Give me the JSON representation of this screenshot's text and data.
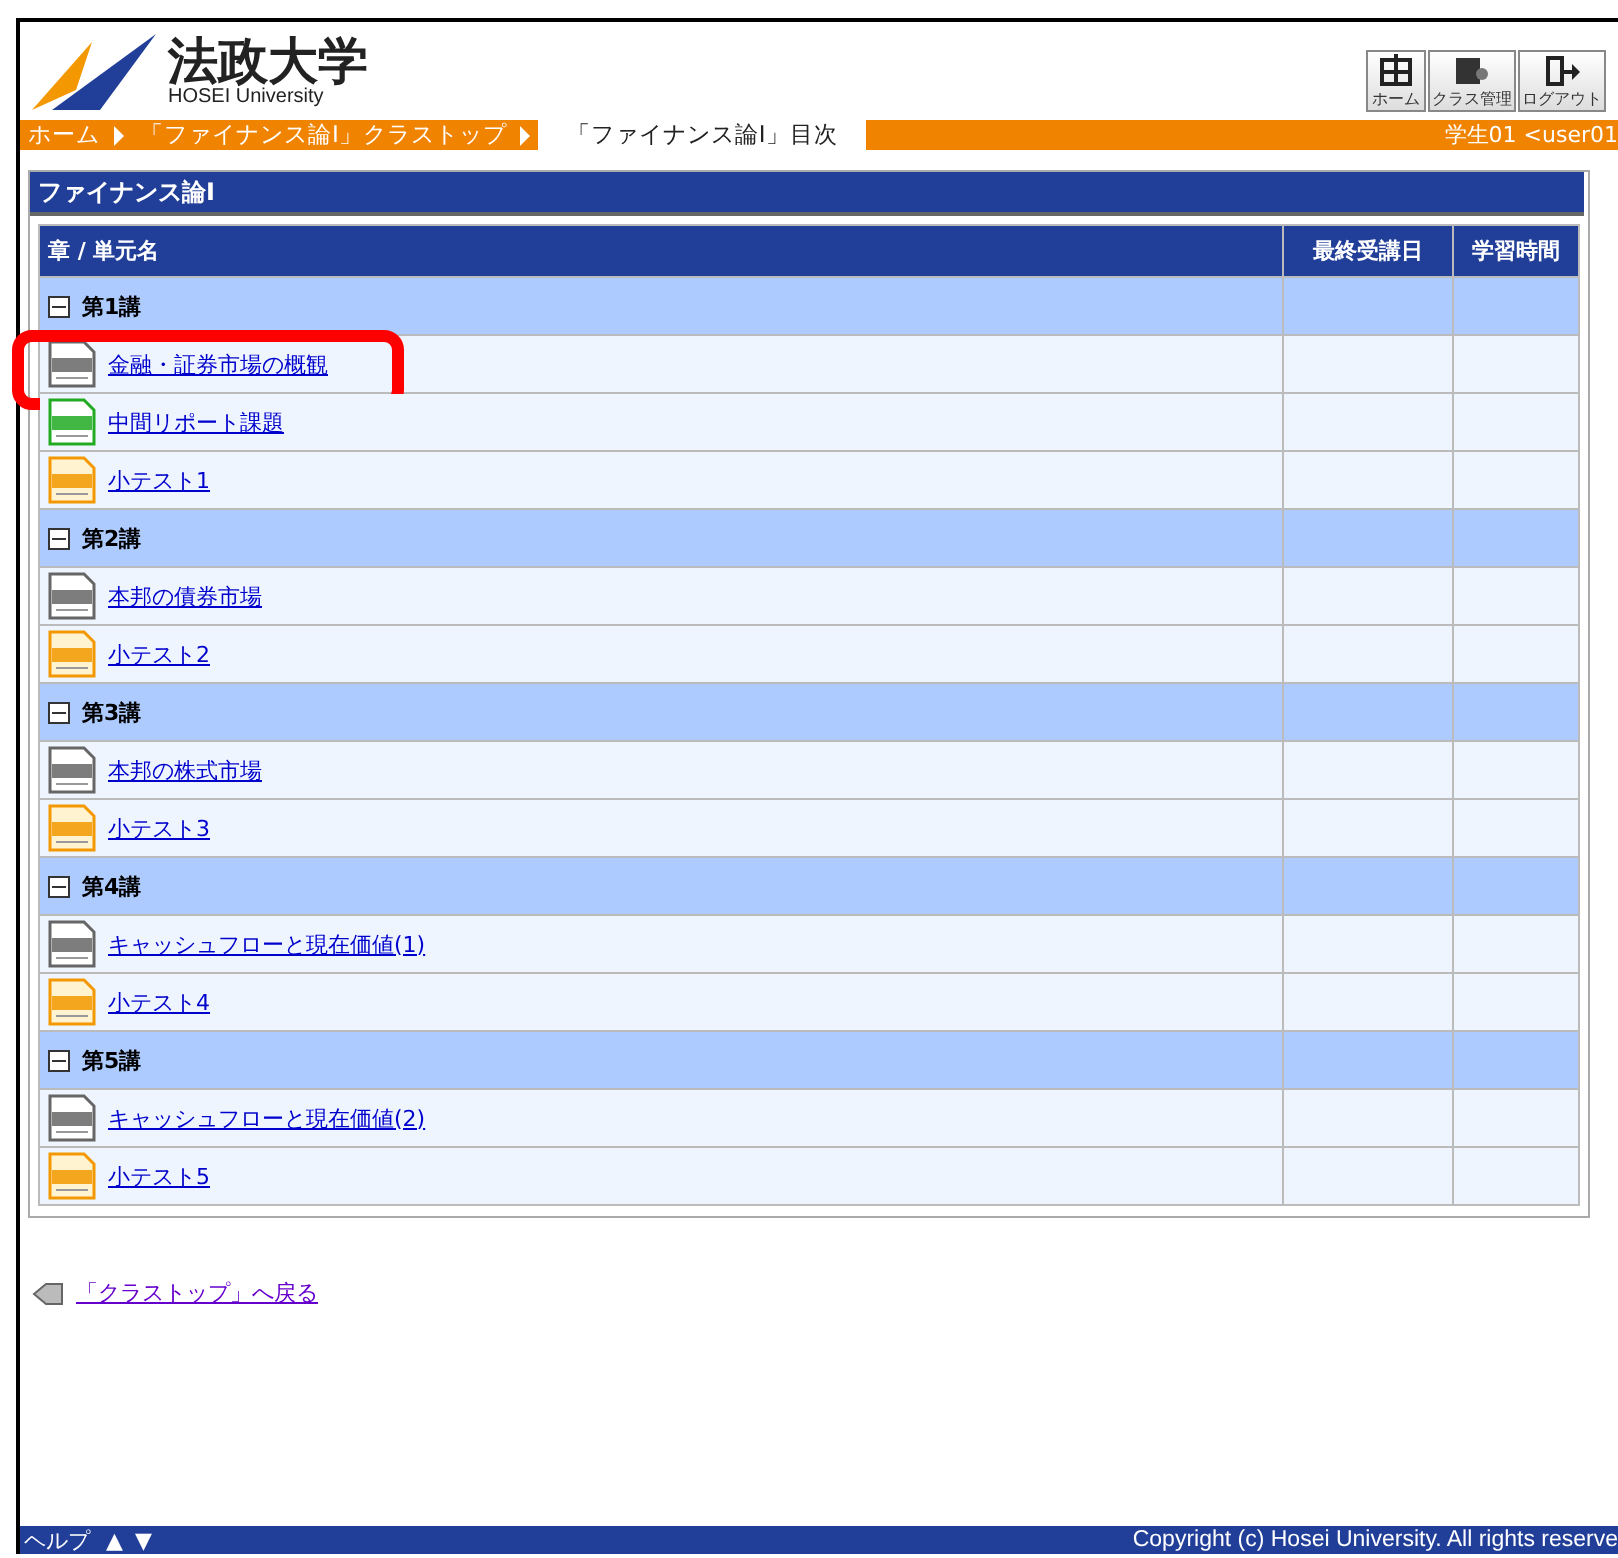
{
  "header": {
    "logo_title": "法政大学",
    "logo_subtitle": "HOSEI University",
    "tools": [
      {
        "kind": "home",
        "label": "ホーム"
      },
      {
        "kind": "class",
        "label": "クラス管理"
      },
      {
        "kind": "logout",
        "label": "ログアウト"
      }
    ]
  },
  "breadcrumb": {
    "items": [
      {
        "label": "ホーム",
        "selected": false
      },
      {
        "label": "「ファイナンス論Ⅰ」クラストップ",
        "selected": false
      },
      {
        "label": "「ファイナンス論Ⅰ」目次",
        "selected": true
      }
    ],
    "user": "学生01 <user01"
  },
  "panel": {
    "title": "ファイナンス論Ⅰ"
  },
  "table": {
    "columns": [
      "章 / 単元名",
      "最終受講日",
      "学習時間"
    ],
    "rows": [
      {
        "kind": "section",
        "label": "第1講",
        "expanded": true
      },
      {
        "kind": "text",
        "label": "金融・証券市場の概観",
        "highlighted": true
      },
      {
        "kind": "report",
        "label": "中間リポート課題",
        "highlighted": false
      },
      {
        "kind": "test",
        "label": "小テスト1",
        "highlighted": false
      },
      {
        "kind": "section",
        "label": "第2講",
        "expanded": true
      },
      {
        "kind": "text",
        "label": "本邦の債券市場",
        "highlighted": false
      },
      {
        "kind": "test",
        "label": "小テスト2",
        "highlighted": false
      },
      {
        "kind": "section",
        "label": "第3講",
        "expanded": true
      },
      {
        "kind": "text",
        "label": "本邦の株式市場",
        "highlighted": false
      },
      {
        "kind": "test",
        "label": "小テスト3",
        "highlighted": false
      },
      {
        "kind": "section",
        "label": "第4講",
        "expanded": true
      },
      {
        "kind": "text",
        "label": "キャッシュフローと現在価値(1)",
        "highlighted": false
      },
      {
        "kind": "test",
        "label": "小テスト4",
        "highlighted": false
      },
      {
        "kind": "section",
        "label": "第5講",
        "expanded": true
      },
      {
        "kind": "text",
        "label": "キャッシュフローと現在価値(2)",
        "highlighted": false
      },
      {
        "kind": "test",
        "label": "小テスト5",
        "highlighted": false
      }
    ]
  },
  "back_link": "「クラストップ」へ戻る",
  "footer": {
    "help": "ヘルプ",
    "up": "▲",
    "down": "▼",
    "copyright": "Copyright (c) Hosei University. All rights reserve"
  }
}
